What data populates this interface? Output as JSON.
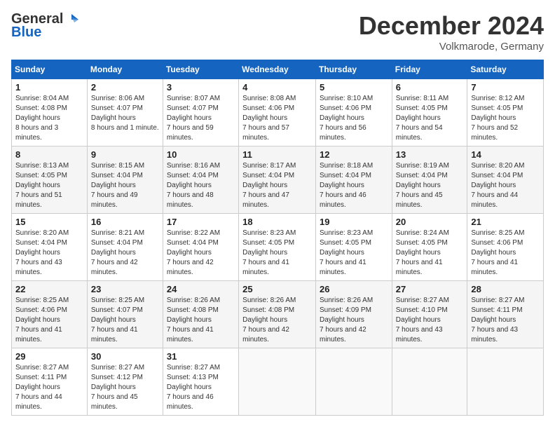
{
  "header": {
    "logo_general": "General",
    "logo_blue": "Blue",
    "month": "December 2024",
    "location": "Volkmarode, Germany"
  },
  "days_of_week": [
    "Sunday",
    "Monday",
    "Tuesday",
    "Wednesday",
    "Thursday",
    "Friday",
    "Saturday"
  ],
  "weeks": [
    [
      {
        "day": 1,
        "sunrise": "8:04 AM",
        "sunset": "4:08 PM",
        "daylight": "8 hours and 3 minutes."
      },
      {
        "day": 2,
        "sunrise": "8:06 AM",
        "sunset": "4:07 PM",
        "daylight": "8 hours and 1 minute."
      },
      {
        "day": 3,
        "sunrise": "8:07 AM",
        "sunset": "4:07 PM",
        "daylight": "7 hours and 59 minutes."
      },
      {
        "day": 4,
        "sunrise": "8:08 AM",
        "sunset": "4:06 PM",
        "daylight": "7 hours and 57 minutes."
      },
      {
        "day": 5,
        "sunrise": "8:10 AM",
        "sunset": "4:06 PM",
        "daylight": "7 hours and 56 minutes."
      },
      {
        "day": 6,
        "sunrise": "8:11 AM",
        "sunset": "4:05 PM",
        "daylight": "7 hours and 54 minutes."
      },
      {
        "day": 7,
        "sunrise": "8:12 AM",
        "sunset": "4:05 PM",
        "daylight": "7 hours and 52 minutes."
      }
    ],
    [
      {
        "day": 8,
        "sunrise": "8:13 AM",
        "sunset": "4:05 PM",
        "daylight": "7 hours and 51 minutes."
      },
      {
        "day": 9,
        "sunrise": "8:15 AM",
        "sunset": "4:04 PM",
        "daylight": "7 hours and 49 minutes."
      },
      {
        "day": 10,
        "sunrise": "8:16 AM",
        "sunset": "4:04 PM",
        "daylight": "7 hours and 48 minutes."
      },
      {
        "day": 11,
        "sunrise": "8:17 AM",
        "sunset": "4:04 PM",
        "daylight": "7 hours and 47 minutes."
      },
      {
        "day": 12,
        "sunrise": "8:18 AM",
        "sunset": "4:04 PM",
        "daylight": "7 hours and 46 minutes."
      },
      {
        "day": 13,
        "sunrise": "8:19 AM",
        "sunset": "4:04 PM",
        "daylight": "7 hours and 45 minutes."
      },
      {
        "day": 14,
        "sunrise": "8:20 AM",
        "sunset": "4:04 PM",
        "daylight": "7 hours and 44 minutes."
      }
    ],
    [
      {
        "day": 15,
        "sunrise": "8:20 AM",
        "sunset": "4:04 PM",
        "daylight": "7 hours and 43 minutes."
      },
      {
        "day": 16,
        "sunrise": "8:21 AM",
        "sunset": "4:04 PM",
        "daylight": "7 hours and 42 minutes."
      },
      {
        "day": 17,
        "sunrise": "8:22 AM",
        "sunset": "4:04 PM",
        "daylight": "7 hours and 42 minutes."
      },
      {
        "day": 18,
        "sunrise": "8:23 AM",
        "sunset": "4:05 PM",
        "daylight": "7 hours and 41 minutes."
      },
      {
        "day": 19,
        "sunrise": "8:23 AM",
        "sunset": "4:05 PM",
        "daylight": "7 hours and 41 minutes."
      },
      {
        "day": 20,
        "sunrise": "8:24 AM",
        "sunset": "4:05 PM",
        "daylight": "7 hours and 41 minutes."
      },
      {
        "day": 21,
        "sunrise": "8:25 AM",
        "sunset": "4:06 PM",
        "daylight": "7 hours and 41 minutes."
      }
    ],
    [
      {
        "day": 22,
        "sunrise": "8:25 AM",
        "sunset": "4:06 PM",
        "daylight": "7 hours and 41 minutes."
      },
      {
        "day": 23,
        "sunrise": "8:25 AM",
        "sunset": "4:07 PM",
        "daylight": "7 hours and 41 minutes."
      },
      {
        "day": 24,
        "sunrise": "8:26 AM",
        "sunset": "4:08 PM",
        "daylight": "7 hours and 41 minutes."
      },
      {
        "day": 25,
        "sunrise": "8:26 AM",
        "sunset": "4:08 PM",
        "daylight": "7 hours and 42 minutes."
      },
      {
        "day": 26,
        "sunrise": "8:26 AM",
        "sunset": "4:09 PM",
        "daylight": "7 hours and 42 minutes."
      },
      {
        "day": 27,
        "sunrise": "8:27 AM",
        "sunset": "4:10 PM",
        "daylight": "7 hours and 43 minutes."
      },
      {
        "day": 28,
        "sunrise": "8:27 AM",
        "sunset": "4:11 PM",
        "daylight": "7 hours and 43 minutes."
      }
    ],
    [
      {
        "day": 29,
        "sunrise": "8:27 AM",
        "sunset": "4:11 PM",
        "daylight": "7 hours and 44 minutes."
      },
      {
        "day": 30,
        "sunrise": "8:27 AM",
        "sunset": "4:12 PM",
        "daylight": "7 hours and 45 minutes."
      },
      {
        "day": 31,
        "sunrise": "8:27 AM",
        "sunset": "4:13 PM",
        "daylight": "7 hours and 46 minutes."
      },
      null,
      null,
      null,
      null
    ]
  ],
  "labels": {
    "sunrise": "Sunrise:",
    "sunset": "Sunset:",
    "daylight": "Daylight hours"
  }
}
